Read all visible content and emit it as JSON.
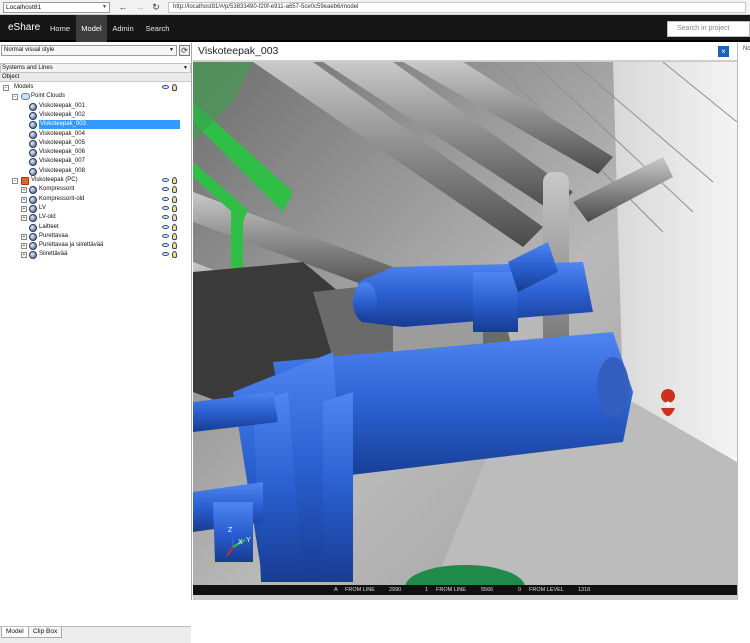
{
  "browser": {
    "tab_select": "Localhost81",
    "url": "http://localhost81/#/p/53833490-f20f-e911-a657-5ce0c59eaeb6/model"
  },
  "nav": {
    "brand": "eShare",
    "items": [
      {
        "label": "Home"
      },
      {
        "label": "Model"
      },
      {
        "label": "Admin"
      },
      {
        "label": "Search"
      }
    ],
    "active": "Model",
    "search_placeholder": "Search in project"
  },
  "left": {
    "visual_style": "Normal visual style",
    "systems": "Systems and Lines",
    "column_header": "Object",
    "tree": [
      {
        "label": "Models",
        "level": 0,
        "expander": "-",
        "icon": "none"
      },
      {
        "label": "Point Clouds",
        "level": 1,
        "expander": "-",
        "icon": "cloud"
      },
      {
        "label": "Viskoteepak_001",
        "level": 2,
        "expander": "",
        "icon": "sphere"
      },
      {
        "label": "Viskoteepak_002",
        "level": 2,
        "expander": "",
        "icon": "sphere"
      },
      {
        "label": "Viskoteepak_003",
        "level": 2,
        "expander": "",
        "icon": "sphere",
        "selected": true
      },
      {
        "label": "Viskoteepak_004",
        "level": 2,
        "expander": "",
        "icon": "sphere"
      },
      {
        "label": "Viskoteepak_005",
        "level": 2,
        "expander": "",
        "icon": "sphere"
      },
      {
        "label": "Viskoteepak_006",
        "level": 2,
        "expander": "",
        "icon": "sphere"
      },
      {
        "label": "Viskoteepak_007",
        "level": 2,
        "expander": "",
        "icon": "sphere"
      },
      {
        "label": "Viskoteepak_008",
        "level": 2,
        "expander": "",
        "icon": "sphere"
      },
      {
        "label": "Viskoteepak (PC)",
        "level": 1,
        "expander": "-",
        "icon": "orange"
      },
      {
        "label": "Kompressorit",
        "level": 2,
        "expander": "+",
        "icon": "sphere"
      },
      {
        "label": "Kompressorit-old",
        "level": 2,
        "expander": "+",
        "icon": "sphere"
      },
      {
        "label": "LV",
        "level": 2,
        "expander": "+",
        "icon": "sphere"
      },
      {
        "label": "LV-old",
        "level": 2,
        "expander": "+",
        "icon": "sphere"
      },
      {
        "label": "Laitteet",
        "level": 2,
        "expander": "",
        "icon": "sphere"
      },
      {
        "label": "Purettavaa",
        "level": 2,
        "expander": "+",
        "icon": "sphere"
      },
      {
        "label": "Purettavaa ja siirettävää",
        "level": 2,
        "expander": "+",
        "icon": "sphere"
      },
      {
        "label": "Siirettävää",
        "level": 2,
        "expander": "+",
        "icon": "sphere"
      }
    ],
    "bottom_tabs": [
      {
        "label": "Model"
      },
      {
        "label": "Clip Box"
      }
    ]
  },
  "viewer": {
    "title": "Viskoteepak_003",
    "close": "×",
    "axes": {
      "z": "Z",
      "y": "Y",
      "x": "X"
    },
    "status": {
      "a": "A",
      "from_line_a": "FROM LINE",
      "val_a": "2990",
      "one": "1",
      "from_line_b": "FROM LINE",
      "val_b": "5566",
      "zero": "0",
      "from_level": "FROM LEVEL",
      "val_c": "1318"
    }
  },
  "right": {
    "truncated": "No"
  },
  "colors": {
    "pipe_blue": "#2a5fcf",
    "pipe_green": "#2fbf46",
    "marker_red": "#c8321e",
    "navbar": "#161616"
  }
}
